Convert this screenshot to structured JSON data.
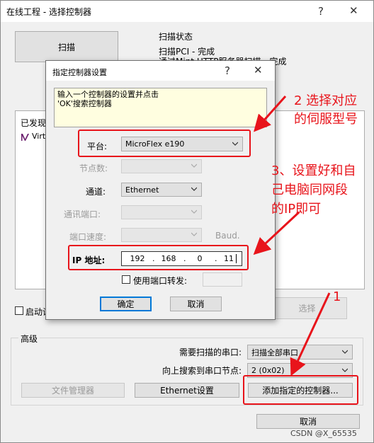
{
  "main_window": {
    "title": "在线工程 - 选择控制器",
    "help_glyph": "?",
    "close_glyph": "✕",
    "scan_button": "扫描",
    "scan_status": {
      "heading": "扫描状态",
      "line1": "扫描PCI - 完成",
      "line2": "通过Mint HTTP服务器扫描 - 完成"
    },
    "found_label": "已发现控",
    "found_item": "Virtu",
    "startup_checkbox": "启动设",
    "select_button": "选择",
    "advanced": {
      "legend": "高级",
      "serial_ports_label": "需要扫描的串口:",
      "serial_ports_value": "扫描全部串口",
      "search_node_label": "向上搜索到串口节点:",
      "search_node_value": "2 (0x02)",
      "file_manager_button": "文件管理器",
      "ethernet_button": "Ethernet设置",
      "add_controller_button": "添加指定的控制器..."
    },
    "cancel_button": "取消"
  },
  "dialog": {
    "title": "指定控制器设置",
    "help_glyph": "?",
    "close_glyph": "✕",
    "info_text": "输入一个控制器的设置并点击\n'OK'搜索控制器",
    "platform_label": "平台:",
    "platform_value": "MicroFlex e190",
    "node_label": "节点数:",
    "channel_label": "通道:",
    "channel_value": "Ethernet",
    "comm_port_label": "通讯端口:",
    "port_speed_label": "端口速度:",
    "baud_unit": "Baud.",
    "ip_label": "IP 地址:",
    "ip": [
      "192",
      "168",
      "0",
      "11"
    ],
    "use_port_forward_label": "使用端口转发:",
    "ok_button": "确定",
    "cancel_button": "取消"
  },
  "annotations": {
    "note_platform_line1": "2 选择对应",
    "note_platform_line2": "的伺服型号",
    "note_ip_line1": "3、设置好和自",
    "note_ip_line2": "己电脑同网段",
    "note_ip_line3": "的IP即可",
    "note_add_number": "1"
  },
  "watermark": "CSDN @X_65535",
  "colors": {
    "annotation_red": "#e8141b",
    "info_box_yellow": "#fffee0",
    "button_face": "#e1e1e1",
    "ok_border": "#0078d7",
    "status_blue": "#0b4ea2"
  }
}
